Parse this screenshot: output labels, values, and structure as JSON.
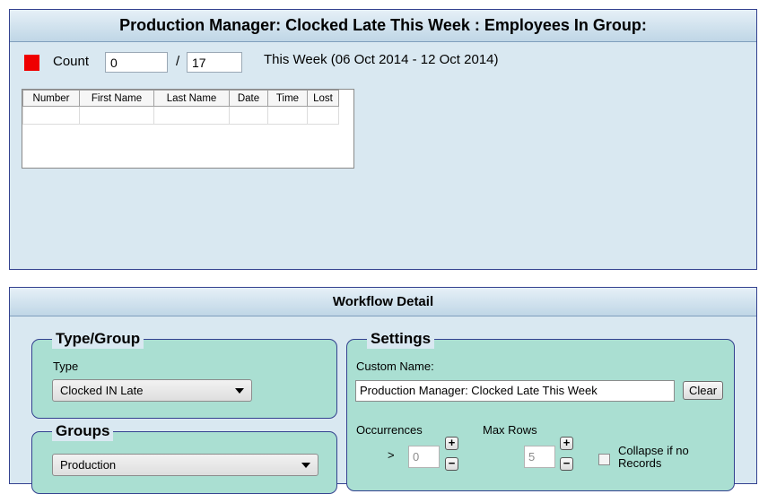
{
  "header": {
    "title": "Production Manager: Clocked Late This Week : Employees In Group:"
  },
  "summary": {
    "count_label": "Count",
    "count_value": "0",
    "separator": "/",
    "total_value": "17",
    "week_text": "This Week (06 Oct 2014 - 12 Oct 2014)"
  },
  "grid": {
    "columns": [
      "Number",
      "First Name",
      "Last Name",
      "Date",
      "Time",
      "Lost"
    ]
  },
  "workflow": {
    "title": "Workflow Detail",
    "type_group": {
      "legend": "Type/Group",
      "type_label": "Type",
      "type_value": "Clocked IN Late"
    },
    "groups": {
      "legend": "Groups",
      "value": "Production"
    },
    "settings": {
      "legend": "Settings",
      "custom_name_label": "Custom Name:",
      "custom_name_value": "Production Manager: Clocked Late This Week",
      "clear_label": "Clear",
      "occurrences_label": "Occurrences",
      "occurrences_op": ">",
      "occurrences_value": "0",
      "max_rows_label": "Max Rows",
      "max_rows_value": "5",
      "collapse_label_1": "Collapse if no",
      "collapse_label_2": "Records"
    }
  },
  "icons": {
    "plus": "+",
    "minus": "−"
  },
  "colors": {
    "panel": "#d9e8f1",
    "group_fill": "#aadfd2",
    "indicator": "#ef0000",
    "border": "#33418f"
  }
}
